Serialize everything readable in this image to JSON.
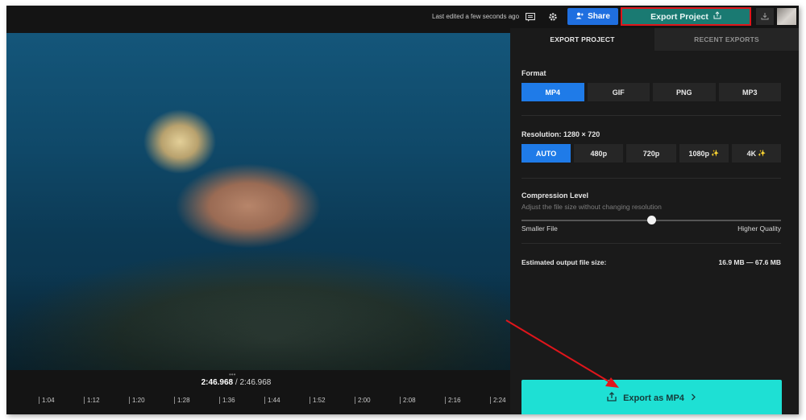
{
  "header": {
    "last_edited": "Last edited a few seconds ago",
    "share_label": "Share",
    "export_label": "Export Project"
  },
  "icons": {
    "comment": "comment-icon",
    "settings": "gear-icon",
    "share": "add-person-icon",
    "export": "upload-icon",
    "download": "download-icon"
  },
  "timeline": {
    "current_time": "2:46.968",
    "separator": "/",
    "total_time": "2:46.968",
    "ticks": [
      "1:04",
      "1:12",
      "1:20",
      "1:28",
      "1:36",
      "1:44",
      "1:52",
      "2:00",
      "2:08",
      "2:16",
      "2:24"
    ]
  },
  "panel": {
    "tabs": [
      "EXPORT PROJECT",
      "RECENT EXPORTS"
    ],
    "format": {
      "title": "Format",
      "options": [
        "MP4",
        "GIF",
        "PNG",
        "MP3"
      ],
      "selected": "MP4"
    },
    "resolution": {
      "title": "Resolution: 1280 × 720",
      "options": [
        "AUTO",
        "480p",
        "720p",
        "1080p",
        "4K"
      ],
      "selected": "AUTO",
      "premium_options": [
        "1080p",
        "4K"
      ]
    },
    "compression": {
      "title": "Compression Level",
      "hint": "Adjust the file size without changing resolution",
      "min_label": "Smaller File",
      "max_label": "Higher Quality",
      "level": 0.5
    },
    "estimate": {
      "label": "Estimated output file size:",
      "value": "16.9 MB — 67.6 MB"
    },
    "export_button": "Export as MP4"
  },
  "colors": {
    "accent_blue": "#1f7be8",
    "export_teal": "#1ee0d4",
    "export_header": "#1a7a72",
    "highlight_red": "#e0151b"
  }
}
